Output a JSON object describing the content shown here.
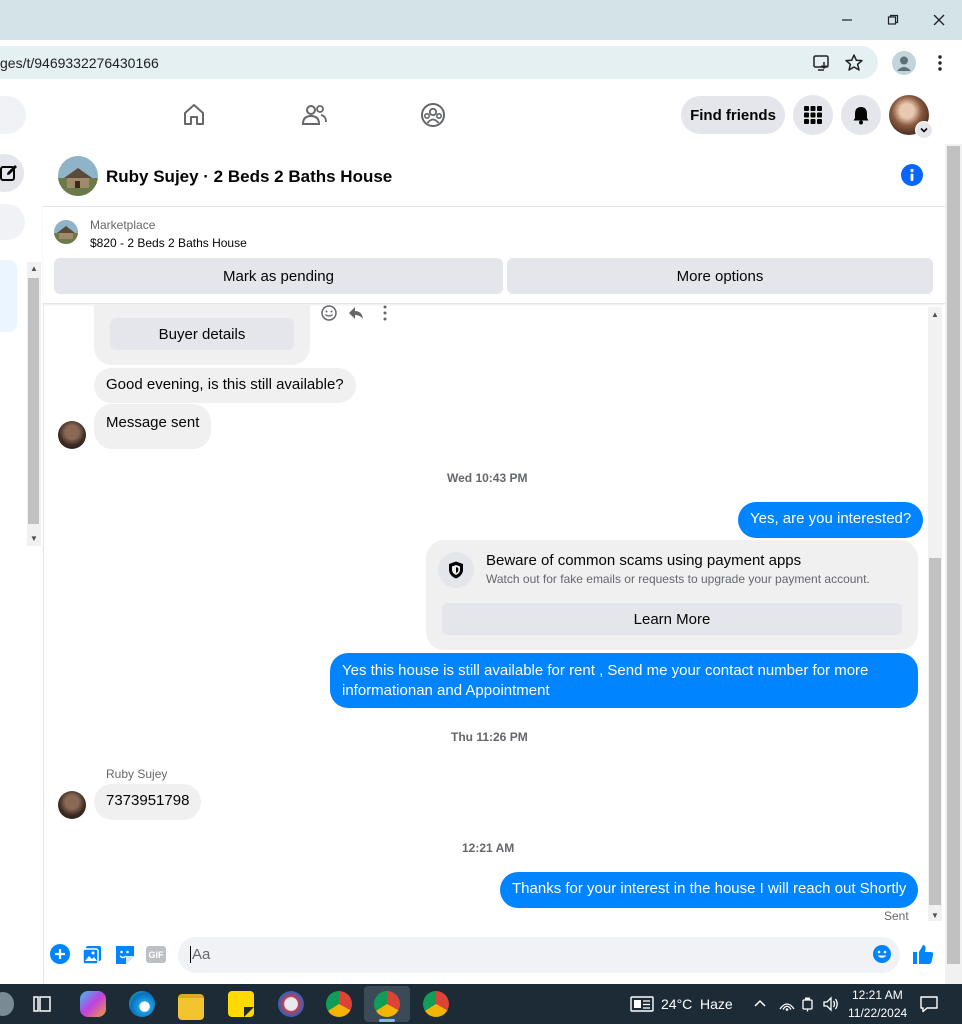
{
  "browser": {
    "url": "ges/t/9469332276430166"
  },
  "header": {
    "find_friends": "Find friends"
  },
  "conversation": {
    "title": "Ruby Sujey · 2 Beds 2 Baths House"
  },
  "listing": {
    "source": "Marketplace",
    "summary": "$820 - 2 Beds 2 Baths House",
    "mark_pending": "Mark as pending",
    "more_options": "More options"
  },
  "messages": {
    "buyer_details": "Buyer details",
    "m1": "Good evening, is this still available?",
    "m2": "Message sent",
    "ts1": "Wed 10:43 PM",
    "m3": "Yes, are you interested?",
    "scam_title": "Beware of common scams using payment apps",
    "scam_sub": "Watch out for fake emails or requests to upgrade your payment account.",
    "learn_more": "Learn More",
    "m4_line1": "Yes this house is still available for rent , Send me your contact number for more",
    "m4_line2": "informationan and Appointment",
    "ts2": "Thu 11:26 PM",
    "sender_name": "Ruby Sujey",
    "m5": "7373951798",
    "ts3": "12:21 AM",
    "m6": "Thanks for your interest in the house I will reach out Shortly",
    "status": "Sent"
  },
  "composer": {
    "placeholder": "Aa"
  },
  "taskbar": {
    "weather_temp": "24°C",
    "weather_desc": "Haze",
    "time": "12:21 AM",
    "date": "11/22/2024"
  },
  "colors": {
    "accent": "#0084ff",
    "fb_blue": "#0866ff"
  }
}
